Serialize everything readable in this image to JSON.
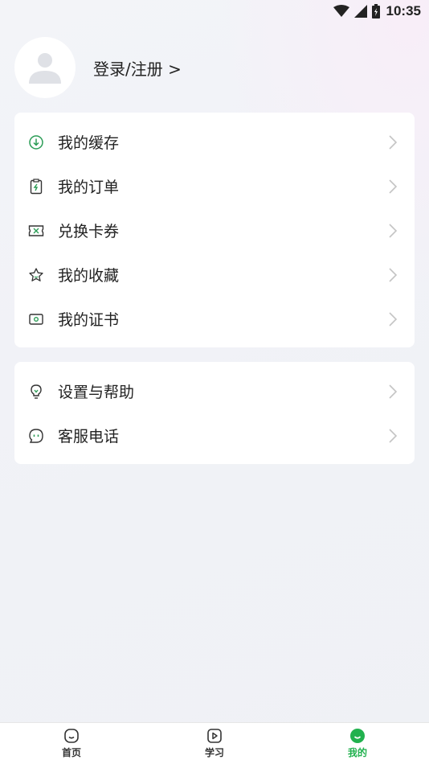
{
  "status_bar": {
    "time": "10:35"
  },
  "profile": {
    "login_label": "登录/注册 >"
  },
  "menu_group_1": [
    {
      "label": "我的缓存",
      "icon": "download-icon"
    },
    {
      "label": "我的订单",
      "icon": "order-clipboard-icon"
    },
    {
      "label": "兑换卡券",
      "icon": "ticket-icon"
    },
    {
      "label": "我的收藏",
      "icon": "star-icon"
    },
    {
      "label": "我的证书",
      "icon": "certificate-icon"
    }
  ],
  "menu_group_2": [
    {
      "label": "设置与帮助",
      "icon": "lightbulb-icon"
    },
    {
      "label": "客服电话",
      "icon": "chat-bubble-icon"
    }
  ],
  "bottom_nav": [
    {
      "label": "首页",
      "icon": "home-face-icon",
      "active": false
    },
    {
      "label": "学习",
      "icon": "play-icon",
      "active": false
    },
    {
      "label": "我的",
      "icon": "profile-face-icon",
      "active": true
    }
  ],
  "colors": {
    "accent": "#21b14e",
    "icon_green": "#2a9c55"
  }
}
